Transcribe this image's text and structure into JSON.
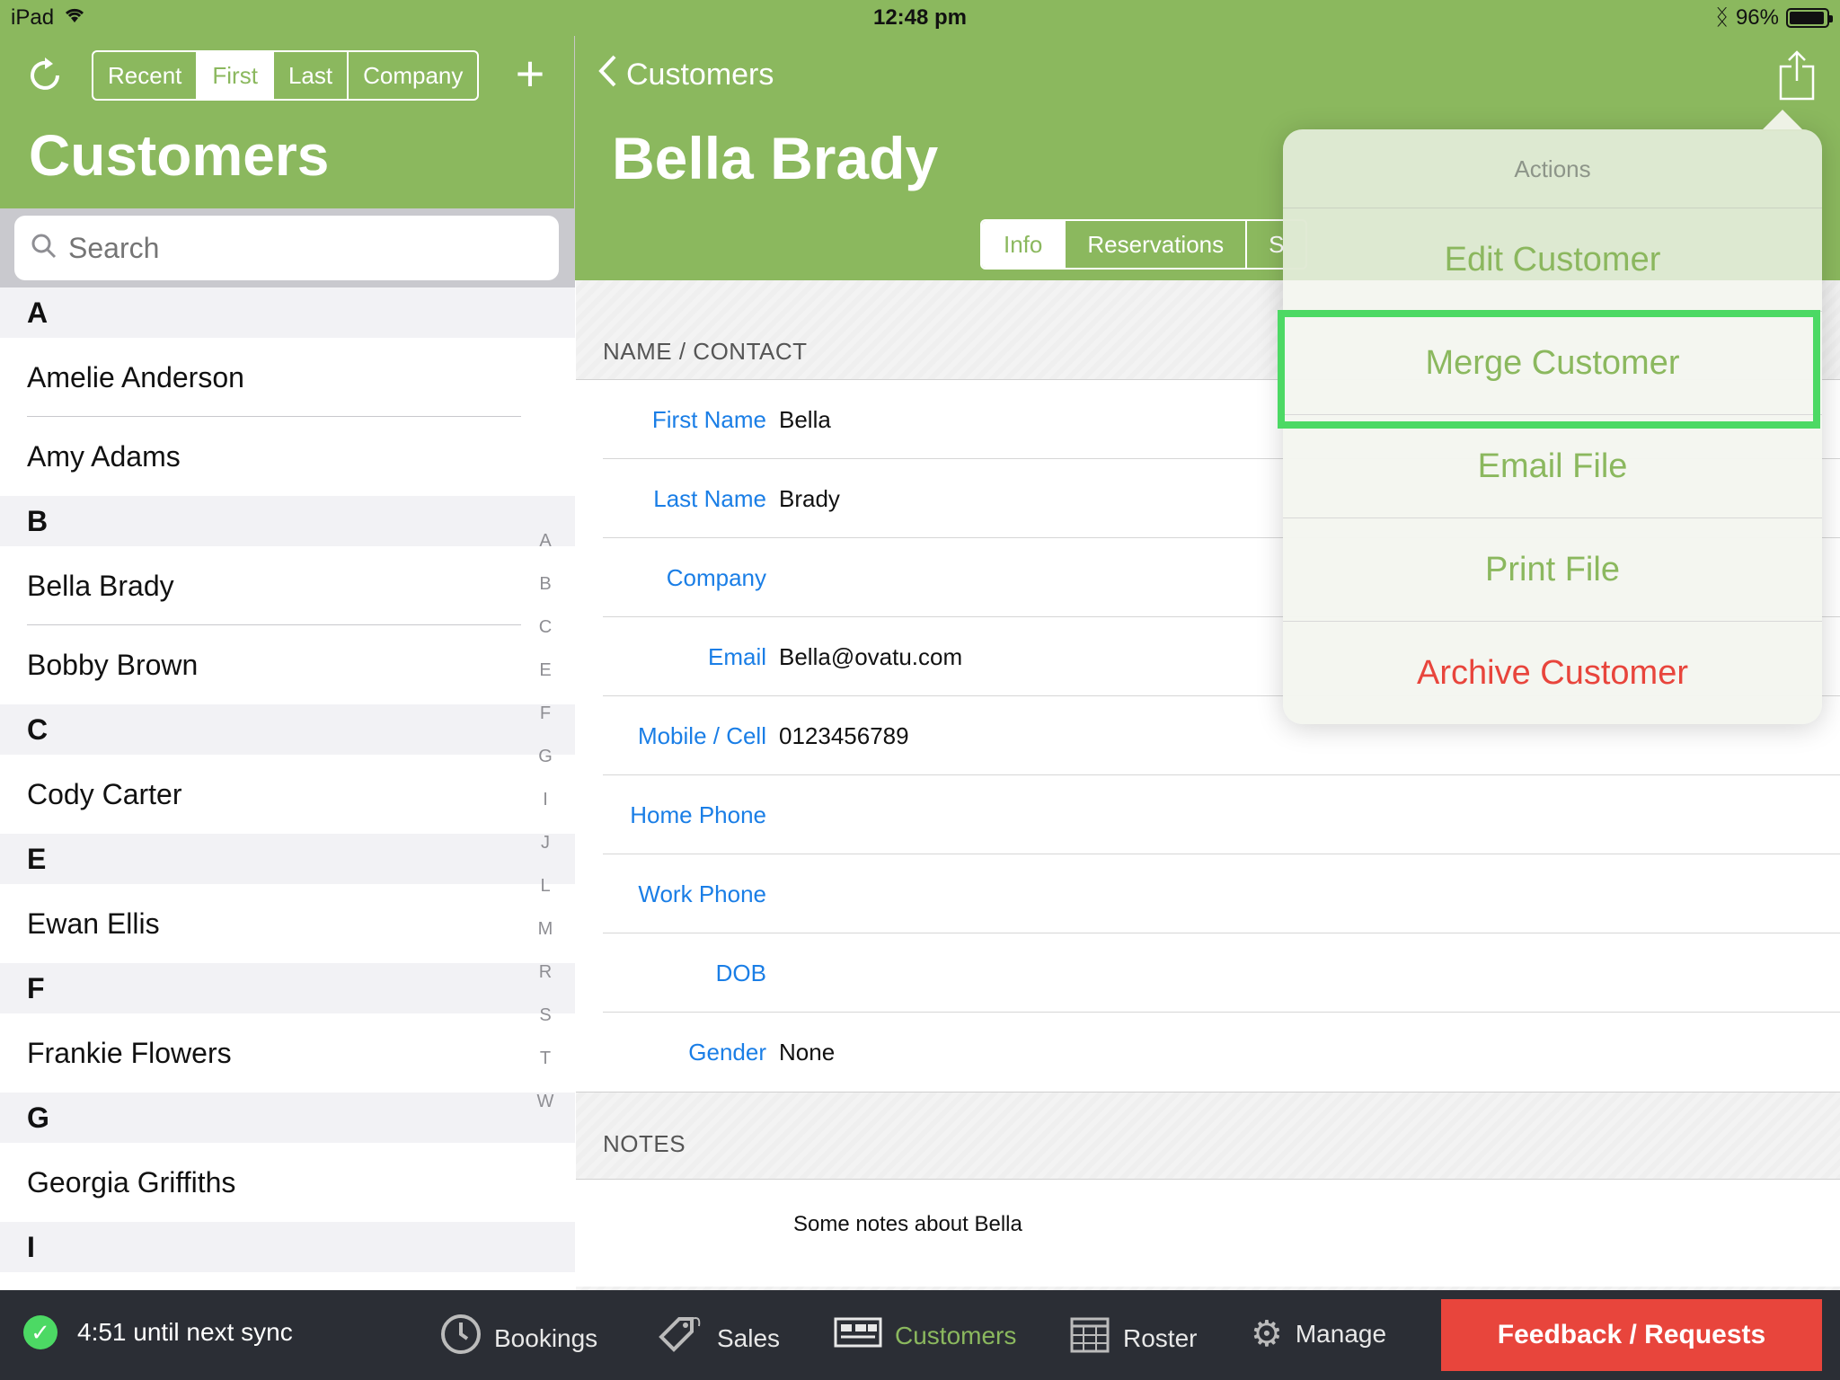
{
  "status_bar": {
    "device": "iPad",
    "time": "12:48 pm",
    "battery": "96%"
  },
  "master": {
    "title": "Customers",
    "segments": [
      "Recent",
      "First",
      "Last",
      "Company"
    ],
    "active_segment": "First",
    "search": {
      "placeholder": "Search"
    },
    "sections": [
      {
        "letter": "A",
        "rows": [
          "Amelie Anderson",
          "Amy Adams"
        ]
      },
      {
        "letter": "B",
        "rows": [
          "Bella Brady",
          "Bobby Brown"
        ]
      },
      {
        "letter": "C",
        "rows": [
          "Cody  Carter"
        ]
      },
      {
        "letter": "E",
        "rows": [
          "Ewan Ellis"
        ]
      },
      {
        "letter": "F",
        "rows": [
          "Frankie Flowers"
        ]
      },
      {
        "letter": "G",
        "rows": [
          "Georgia Griffiths"
        ]
      },
      {
        "letter": "I",
        "rows": []
      }
    ],
    "index": [
      "A",
      "B",
      "C",
      "E",
      "F",
      "G",
      "I",
      "J",
      "L",
      "M",
      "R",
      "S",
      "T",
      "W"
    ]
  },
  "detail": {
    "back_label": "Customers",
    "title": "Bella Brady",
    "tabs": [
      "Info",
      "Reservations",
      "S"
    ],
    "active_tab": "Info",
    "name_contact_label": "NAME / CONTACT",
    "fields": [
      {
        "label": "First Name",
        "value": "Bella"
      },
      {
        "label": "Last Name",
        "value": "Brady"
      },
      {
        "label": "Company",
        "value": ""
      },
      {
        "label": "Email",
        "value": "Bella@ovatu.com"
      },
      {
        "label": "Mobile / Cell",
        "value": "0123456789"
      },
      {
        "label": "Home Phone",
        "value": ""
      },
      {
        "label": "Work Phone",
        "value": ""
      },
      {
        "label": "DOB",
        "value": ""
      },
      {
        "label": "Gender",
        "value": "None"
      }
    ],
    "notes_label": "NOTES",
    "notes_text": "Some notes about Bella"
  },
  "popover": {
    "title": "Actions",
    "items": [
      "Edit Customer",
      "Merge Customer",
      "Email File",
      "Print File",
      "Archive Customer"
    ],
    "highlighted": "Merge Customer",
    "danger": "Archive Customer"
  },
  "bottom_bar": {
    "sync": "4:51 until next sync",
    "nav": [
      "Bookings",
      "Sales",
      "Customers",
      "Roster",
      "Manage"
    ],
    "active_nav": "Customers",
    "feedback": "Feedback / Requests"
  },
  "colors": {
    "brand_green": "#8bb85e",
    "link_blue": "#1a7ee6",
    "danger_red": "#e8453c",
    "highlight_green": "#4cd964",
    "bottom_bar_bg": "#2b2e35"
  }
}
